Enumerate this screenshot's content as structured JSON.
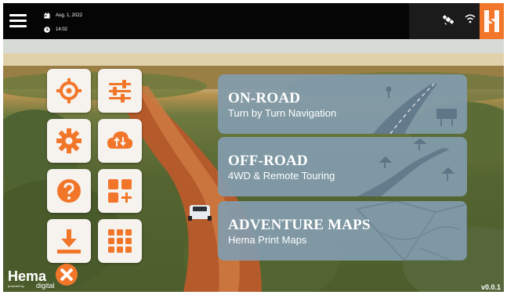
{
  "status": {
    "date": "Aug. 1, 2022",
    "time": "14:02"
  },
  "icons": {
    "menu": "hamburger-menu-icon",
    "calendar": "calendar-icon",
    "clock": "clock-icon",
    "satellite": "satellite-icon",
    "wifi": "wifi-icon",
    "brand": "hema-h-logo-icon"
  },
  "tiles": [
    {
      "name": "gps-locate",
      "icon": "crosshair-icon"
    },
    {
      "name": "settings-sliders",
      "icon": "sliders-icon"
    },
    {
      "name": "settings",
      "icon": "gear-icon"
    },
    {
      "name": "cloud-sync",
      "icon": "cloud-sync-icon"
    },
    {
      "name": "help",
      "icon": "question-icon"
    },
    {
      "name": "add-apps",
      "icon": "grid-plus-icon"
    },
    {
      "name": "download",
      "icon": "download-icon"
    },
    {
      "name": "app-grid",
      "icon": "grid-icon"
    }
  ],
  "cards": [
    {
      "title": "ON-ROAD",
      "subtitle": "Turn by Turn Navigation"
    },
    {
      "title": "OFF-ROAD",
      "subtitle": "4WD & Remote Touring"
    },
    {
      "title": "ADVENTURE MAPS",
      "subtitle": "Hema Print Maps"
    }
  ],
  "logo": {
    "word": "Hema",
    "tagline": "powered by",
    "digital": "digital"
  },
  "version": "v0.0.1",
  "colors": {
    "accent": "#f2762a",
    "topbar": "#050505",
    "card": "#829cac",
    "tile": "#f6f3ef"
  }
}
